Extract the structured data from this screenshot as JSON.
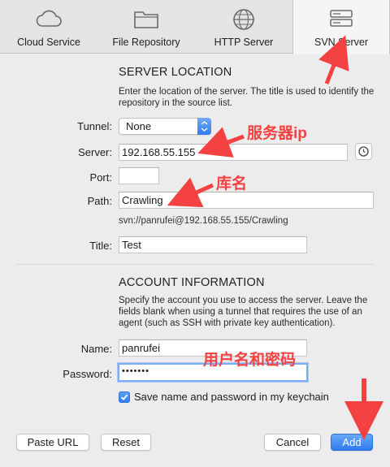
{
  "toolbar": {
    "tabs": [
      {
        "label": "Cloud Service",
        "icon": "cloud-icon"
      },
      {
        "label": "File Repository",
        "icon": "folder-icon"
      },
      {
        "label": "HTTP Server",
        "icon": "globe-icon"
      },
      {
        "label": "SVN Server",
        "icon": "server-icon",
        "selected": true
      }
    ]
  },
  "server_location": {
    "title": "SERVER LOCATION",
    "description": "Enter the location of the server. The title is used to identify the repository in the source list.",
    "tunnel_label": "Tunnel:",
    "tunnel_value": "None",
    "server_label": "Server:",
    "server_value": "192.168.55.155",
    "port_label": "Port:",
    "port_value": "",
    "path_label": "Path:",
    "path_value": "Crawling",
    "resolved_url": "svn://panrufei@192.168.55.155/Crawling",
    "title_label": "Title:",
    "title_value": "Test"
  },
  "account": {
    "title": "ACCOUNT INFORMATION",
    "description": "Specify the account you use to access the server. Leave the fields blank when using a tunnel that requires the use of an agent (such as SSH with private key authentication).",
    "name_label": "Name:",
    "name_value": "panrufei",
    "password_label": "Password:",
    "password_value": "•••••••",
    "keychain_label": "Save name and password in my keychain",
    "keychain_checked": true
  },
  "buttons": {
    "paste_url": "Paste URL",
    "reset": "Reset",
    "cancel": "Cancel",
    "add": "Add"
  },
  "annotations": {
    "server_ip": "服务器ip",
    "repo_name": "库名",
    "user_password": "用户名和密码"
  },
  "colors": {
    "annotation": "#f44242",
    "accent": "#2e7cf1"
  }
}
